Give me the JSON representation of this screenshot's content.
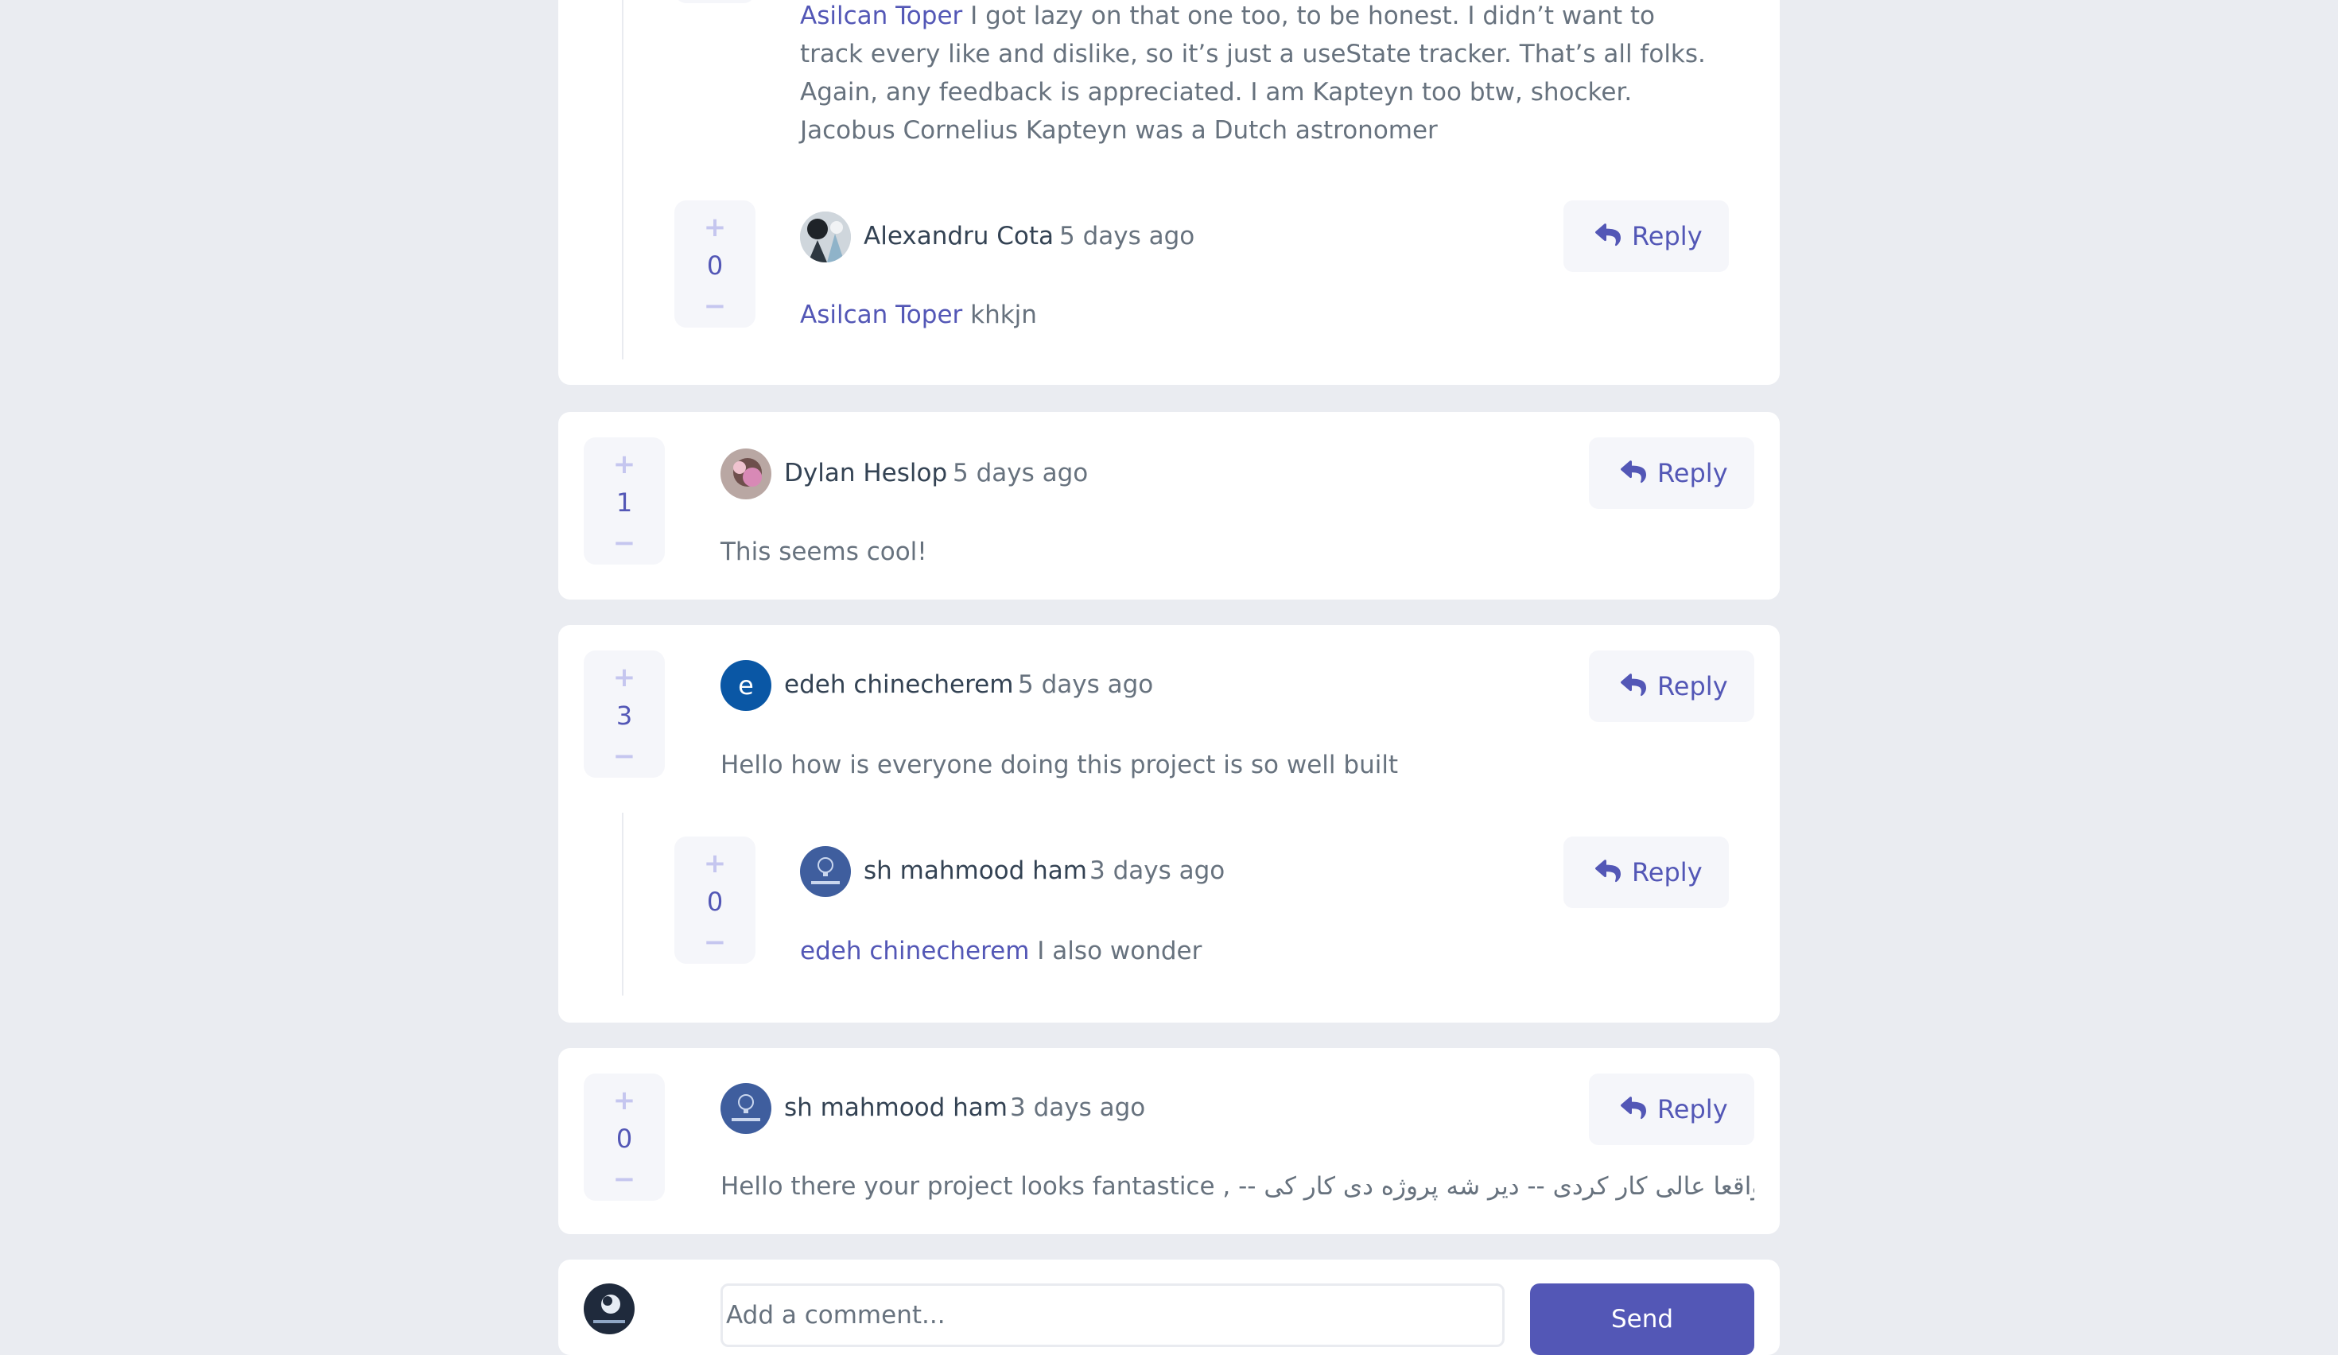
{
  "comments": [
    {
      "mention": "Asilcan Toper",
      "text": " I got lazy on that one too, to be honest. I didn’t want to track every like and dislike, so it’s just a useState tracker. That’s all folks. Again, any feedback is appreciated. I am Kapteyn too btw, shocker. Jacobus Cornelius Kapteyn was a Dutch astronomer",
      "reply_label": "Reply"
    },
    {
      "user": "Alexandru Cota",
      "time": "5 days ago",
      "score": "0",
      "mention": "Asilcan Toper",
      "text": " khkjn",
      "reply_label": "Reply"
    },
    {
      "user": "Dylan Heslop",
      "time": "5 days ago",
      "score": "1",
      "text": "This seems cool!",
      "reply_label": "Reply"
    },
    {
      "user": "edeh chinecherem",
      "avatar_letter": "e",
      "time": "5 days ago",
      "score": "3",
      "text": "Hello how is everyone doing this project is so well built",
      "reply_label": "Reply"
    },
    {
      "user": "sh mahmood ham",
      "time": "3 days ago",
      "score": "0",
      "mention": "edeh chinecherem",
      "text": " I also wonder",
      "reply_label": "Reply"
    },
    {
      "user": "sh mahmood ham",
      "time": "3 days ago",
      "score": "0",
      "text": "Hello there your project looks fantastice , -- واقعا عالی کار کردی -- دیر شه پروژه دی کار کی --",
      "reply_label": "Reply"
    }
  ],
  "vote": {
    "plus": "+",
    "minus": "−"
  },
  "new_comment": {
    "placeholder": "Add a comment...",
    "send_label": "Send"
  },
  "colors": {
    "accent": "#5357b6",
    "background": "#eaecf1",
    "card": "#ffffff",
    "vote_bg": "#f5f6fa",
    "avatar_e": "#0a57a5"
  }
}
